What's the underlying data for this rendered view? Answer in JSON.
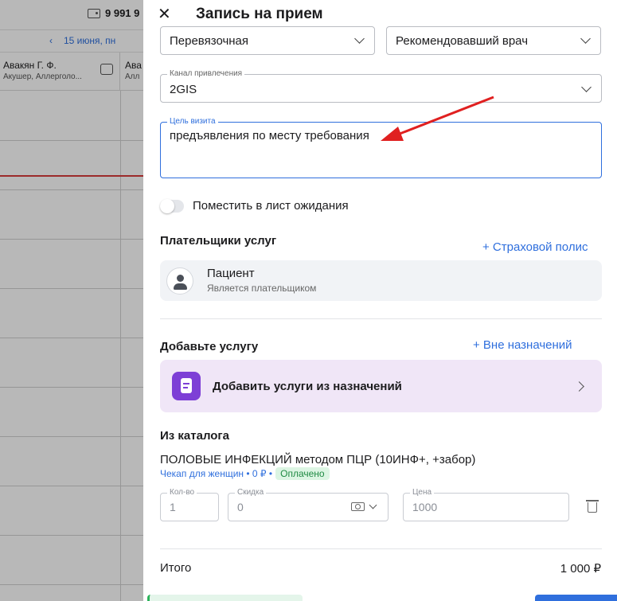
{
  "background": {
    "balance": "9 991 9",
    "date": "15 июня, пн",
    "prev_icon": "chevron-left-icon",
    "doctor": {
      "name": "Авакян Г. Ф.",
      "specialty": "Акушер, Аллерголо..."
    },
    "doctor2": {
      "name": "Ава",
      "specialty": "Алл"
    }
  },
  "modal": {
    "title": "Запись на прием",
    "fields": {
      "room": {
        "value": "Перевязочная"
      },
      "referrer": {
        "value": "Рекомендовавший врач"
      },
      "channel": {
        "label": "Канал привлечения",
        "value": "2GIS"
      },
      "purpose": {
        "label": "Цель визита",
        "value": "предъявления по месту требования"
      }
    },
    "waitlist_label": "Поместить в лист ожидания",
    "payers": {
      "title": "Плательщики услуг",
      "add_link": "+ Страховой полис",
      "card": {
        "name": "Пациент",
        "subtitle": "Является плательщиком"
      }
    },
    "add_service": {
      "title": "Добавьте услугу",
      "link": "+ Вне назначений",
      "card_label": "Добавить услуги из назначений"
    },
    "catalog": {
      "title": "Из каталога",
      "service": "ПОЛОВЫЕ ИНФЕКЦИЙ методом ПЦР (10ИНФ+, +забор)",
      "meta": "Чекап для женщин • 0 ₽ •",
      "status": "Оплачено",
      "qty": {
        "label": "Кол-во",
        "value": "1"
      },
      "discount": {
        "label": "Скидка",
        "value": "0"
      },
      "price": {
        "label": "Цена",
        "value": "1000"
      }
    },
    "total": {
      "label": "Итого",
      "value": "1 000 ₽"
    }
  },
  "colors": {
    "accent": "#2f6fdd",
    "purple": "#7d3fd6",
    "arrow": "#e02020",
    "paid": "#1f8a43"
  }
}
